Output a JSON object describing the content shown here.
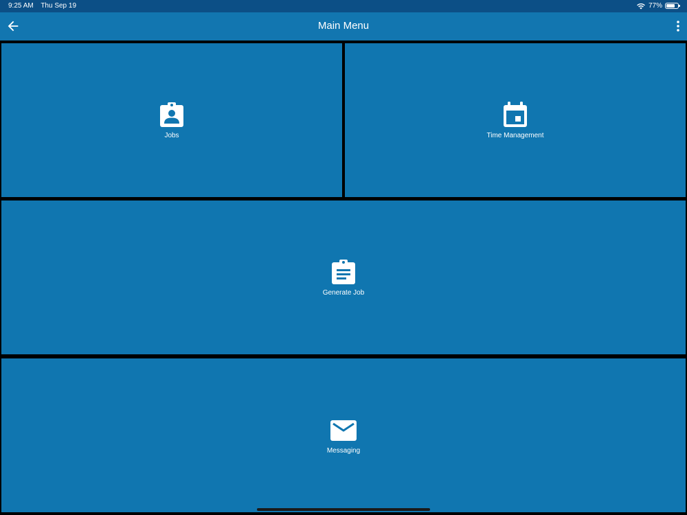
{
  "status_bar": {
    "time": "9:25 AM",
    "date": "Thu Sep 19",
    "battery_percent_label": "77%",
    "battery_level": 0.77,
    "wifi_icon": "wifi-icon",
    "battery_icon": "battery-icon"
  },
  "app_bar": {
    "title": "Main Menu",
    "back_icon": "arrow-left-icon",
    "more_icon": "more-vertical-icon"
  },
  "menu": {
    "jobs": {
      "label": "Jobs",
      "icon": "clipboard-account-icon"
    },
    "time_management": {
      "label": "Time Management",
      "icon": "calendar-icon"
    },
    "generate_job": {
      "label": "Generate Job",
      "icon": "clipboard-text-icon"
    },
    "messaging": {
      "label": "Messaging",
      "icon": "envelope-icon"
    }
  },
  "colors": {
    "status_bar": "#0c4f86",
    "app_bar": "#1276b0",
    "tile": "#1076b0",
    "background": "#000000",
    "foreground": "#ffffff"
  }
}
